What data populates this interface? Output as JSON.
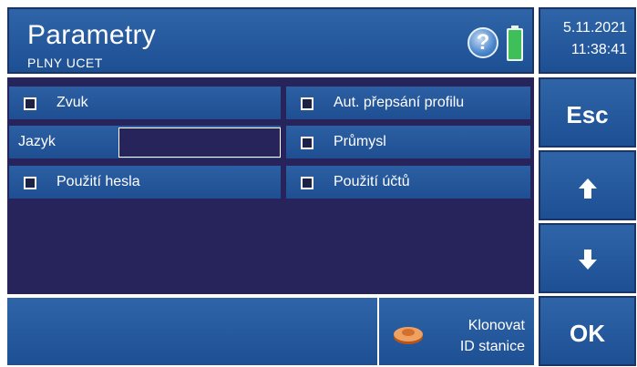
{
  "header": {
    "title": "Parametry",
    "subtitle": "PLNY UCET",
    "help_icon": "question-icon",
    "battery_icon": "battery-icon"
  },
  "clock": {
    "date": "5.11.2021",
    "time": "11:38:41"
  },
  "settings": {
    "left": [
      {
        "label": "Zvuk",
        "type": "checkbox",
        "checked": false
      },
      {
        "label": "Jazyk",
        "type": "input",
        "value": ""
      },
      {
        "label": "Použití hesla",
        "type": "checkbox",
        "checked": false
      }
    ],
    "right": [
      {
        "label": "Aut. přepsání profilu",
        "type": "checkbox",
        "checked": false
      },
      {
        "label": "Průmysl",
        "type": "checkbox",
        "checked": false
      },
      {
        "label": "Použití účtů",
        "type": "checkbox",
        "checked": false
      }
    ]
  },
  "footer": {
    "clone_line1": "Klonovat",
    "clone_line2": "ID stanice"
  },
  "side": {
    "esc_label": "Esc",
    "up_icon": "arrow-up-icon",
    "down_icon": "arrow-down-icon",
    "ok_label": "OK"
  },
  "colors": {
    "panel_blue": "#2f65a8",
    "dark_navy": "#26245a",
    "battery_green": "#3fbf5a"
  }
}
